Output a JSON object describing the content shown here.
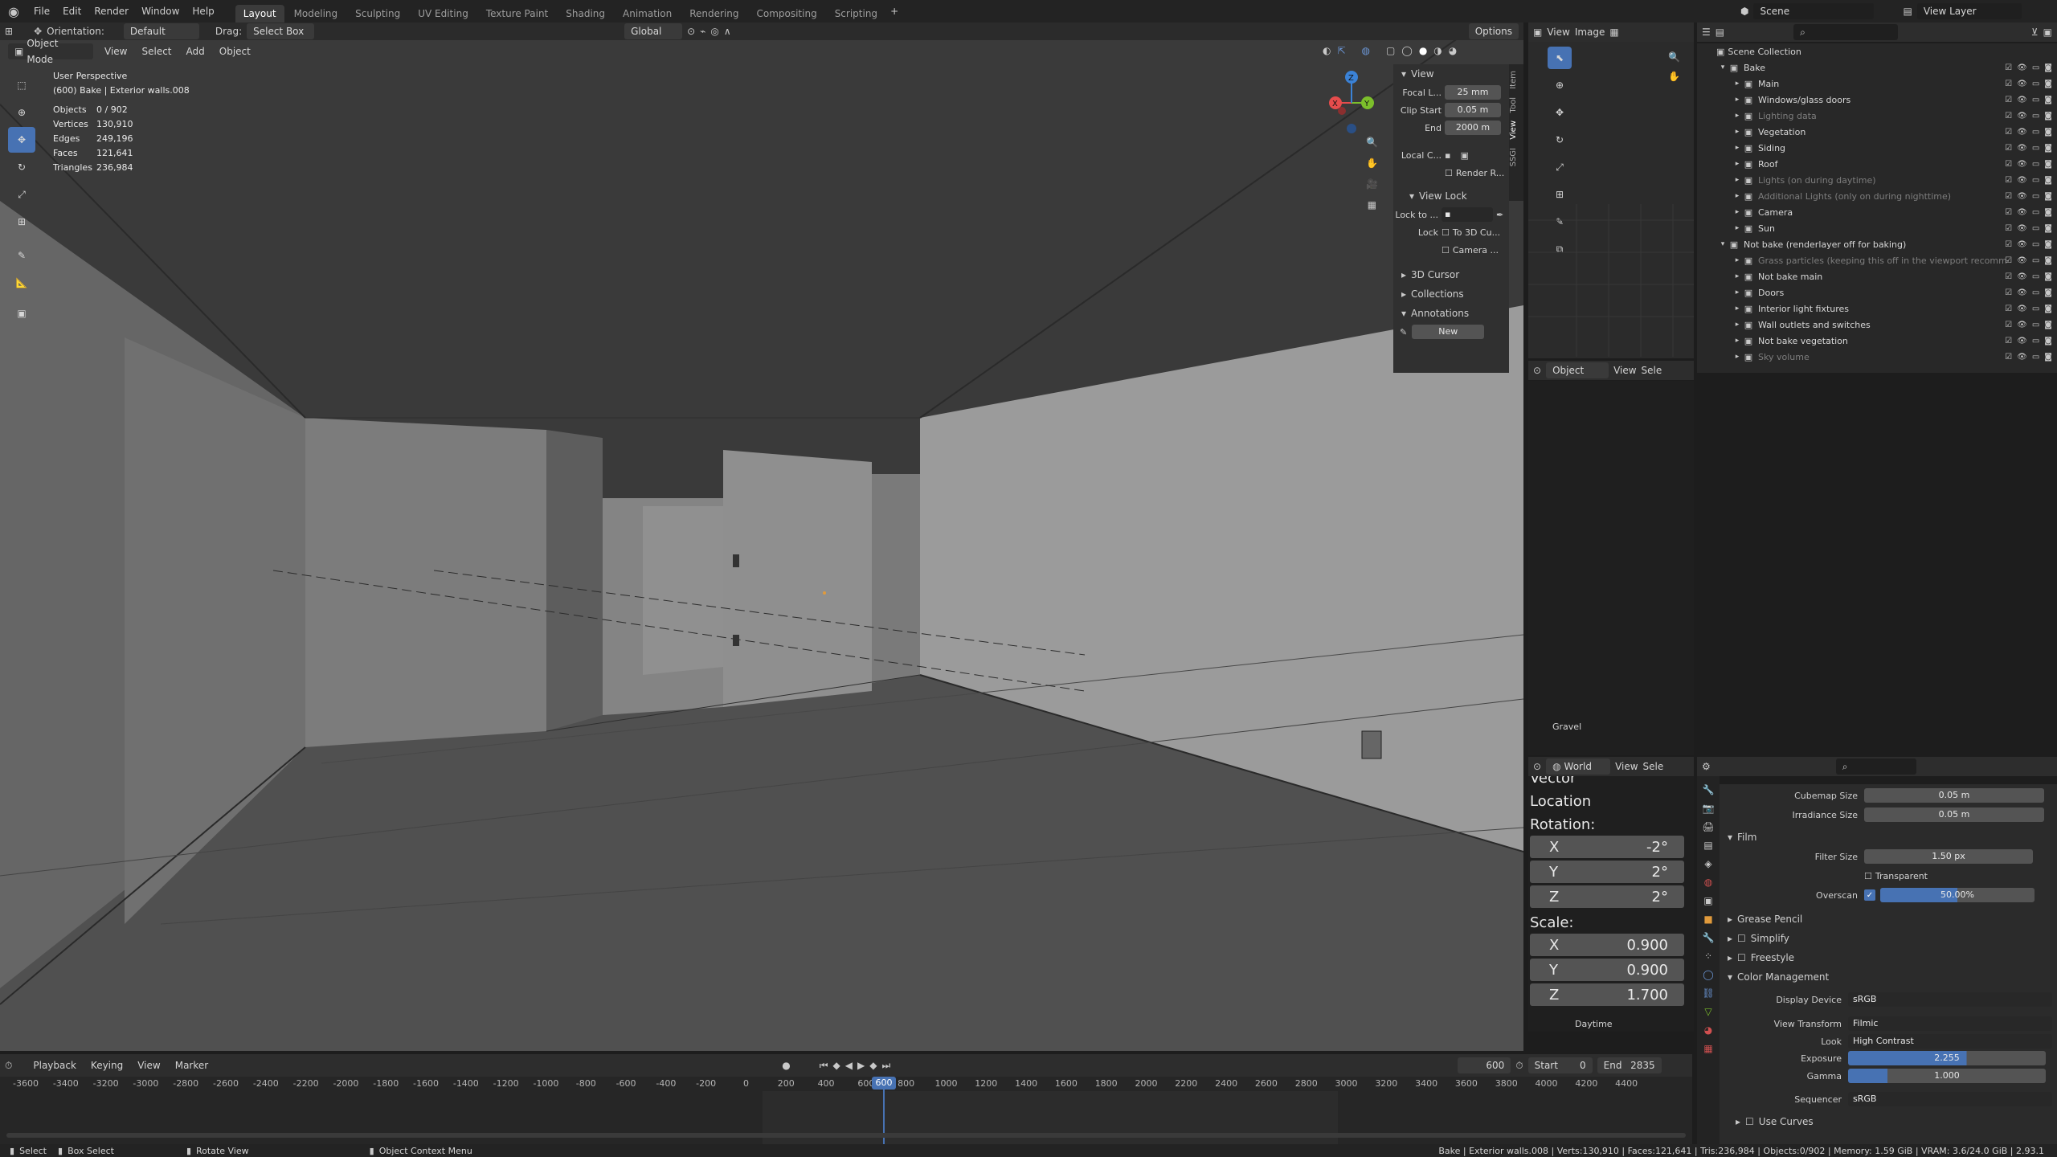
{
  "topbar": {
    "menus": [
      "File",
      "Edit",
      "Render",
      "Window",
      "Help"
    ],
    "workspaces": [
      "Layout",
      "Modeling",
      "Sculpting",
      "UV Editing",
      "Texture Paint",
      "Shading",
      "Animation",
      "Rendering",
      "Compositing",
      "Scripting"
    ],
    "active_workspace": "Layout",
    "scene_label": "Scene",
    "view_layer_label": "View Layer"
  },
  "tool_header": {
    "orientation_label": "Orientation:",
    "orientation_value": "Default",
    "drag_label": "Drag:",
    "drag_value": "Select Box",
    "transform_orientation": "Global",
    "options_label": "Options"
  },
  "viewport_header": {
    "mode": "Object Mode",
    "menus": [
      "View",
      "Select",
      "Add",
      "Object"
    ]
  },
  "viewport_overlay": {
    "perspective": "User Perspective",
    "object_info": "(600) Bake | Exterior walls.008",
    "stats": [
      {
        "label": "Objects",
        "value": "0 / 902"
      },
      {
        "label": "Vertices",
        "value": "130,910"
      },
      {
        "label": "Edges",
        "value": "249,196"
      },
      {
        "label": "Faces",
        "value": "121,641"
      },
      {
        "label": "Triangles",
        "value": "236,984"
      }
    ]
  },
  "npanel": {
    "tabs": [
      "Item",
      "Tool",
      "View",
      "SSGI"
    ],
    "view_header": "View",
    "focal_label": "Focal L...",
    "focal_value": "25 mm",
    "clip_start_label": "Clip Start",
    "clip_start_value": "0.05 m",
    "clip_end_label": "End",
    "clip_end_value": "2000 m",
    "local_camera_label": "Local C...",
    "render_region_label": "Render R...",
    "view_lock_header": "View Lock",
    "lock_to_label": "Lock to ...",
    "lock_label": "Lock",
    "lock_3d_cursor": "To 3D Cu...",
    "lock_camera": "Camera ...",
    "sections": [
      "3D Cursor",
      "Collections",
      "Annotations"
    ],
    "new_button": "New"
  },
  "image_editor": {
    "menus": [
      "View",
      "Image"
    ],
    "image_label": "Gravel",
    "obj_header_mode": "Object",
    "obj_header_menus": [
      "View",
      "Sele"
    ]
  },
  "world_panel": {
    "mode": "World",
    "menus": [
      "View",
      "Sele"
    ],
    "vector_label": "Vector",
    "location_label": "Location",
    "rotation_label": "Rotation:",
    "rotation": [
      {
        "axis": "X",
        "value": "-2°"
      },
      {
        "axis": "Y",
        "value": "2°"
      },
      {
        "axis": "Z",
        "value": "2°"
      }
    ],
    "scale_label": "Scale:",
    "scale": [
      {
        "axis": "X",
        "value": "0.900"
      },
      {
        "axis": "Y",
        "value": "0.900"
      },
      {
        "axis": "Z",
        "value": "1.700"
      }
    ],
    "footer_label": "Daytime"
  },
  "outliner": {
    "root": "Scene Collection",
    "rows": [
      {
        "label": "Bake",
        "indent": 1,
        "expanded": true,
        "dim": false
      },
      {
        "label": "Main",
        "indent": 2,
        "dim": false
      },
      {
        "label": "Windows/glass doors",
        "indent": 2,
        "dim": false
      },
      {
        "label": "Lighting data",
        "indent": 2,
        "dim": true
      },
      {
        "label": "Vegetation",
        "indent": 2,
        "dim": false
      },
      {
        "label": "Siding",
        "indent": 2,
        "dim": false
      },
      {
        "label": "Roof",
        "indent": 2,
        "dim": false
      },
      {
        "label": "Lights (on during daytime)",
        "indent": 2,
        "dim": true
      },
      {
        "label": "Additional Lights (only on during nighttime)",
        "indent": 2,
        "dim": true
      },
      {
        "label": "Camera",
        "indent": 2,
        "dim": false
      },
      {
        "label": "Sun",
        "indent": 2,
        "dim": false
      },
      {
        "label": "Not bake (renderlayer off for baking)",
        "indent": 1,
        "expanded": true,
        "dim": false
      },
      {
        "label": "Grass particles (keeping this off in the viewport recomm",
        "indent": 2,
        "dim": true
      },
      {
        "label": "Not bake main",
        "indent": 2,
        "dim": false
      },
      {
        "label": "Doors",
        "indent": 2,
        "dim": false
      },
      {
        "label": "Interior light fixtures",
        "indent": 2,
        "dim": false
      },
      {
        "label": "Wall outlets and switches",
        "indent": 2,
        "dim": false
      },
      {
        "label": "Not bake vegetation",
        "indent": 2,
        "dim": false
      },
      {
        "label": "Sky volume",
        "indent": 2,
        "dim": true
      }
    ]
  },
  "properties": {
    "cubemap_label": "Cubemap Size",
    "cubemap_value": "0.05 m",
    "irradiance_label": "Irradiance Size",
    "irradiance_value": "0.05 m",
    "film_header": "Film",
    "filter_label": "Filter Size",
    "filter_value": "1.50 px",
    "transparent_label": "Transparent",
    "overscan_label": "Overscan",
    "overscan_value": "50.00%",
    "overscan_fraction": 0.5,
    "grease_pencil": "Grease Pencil",
    "simplify": "Simplify",
    "freestyle": "Freestyle",
    "color_mgmt": "Color Management",
    "display_device_label": "Display Device",
    "display_device_value": "sRGB",
    "view_transform_label": "View Transform",
    "view_transform_value": "Filmic",
    "look_label": "Look",
    "look_value": "High Contrast",
    "exposure_label": "Exposure",
    "exposure_value": "2.255",
    "gamma_label": "Gamma",
    "gamma_value": "1.000",
    "sequencer_label": "Sequencer",
    "sequencer_value": "sRGB",
    "use_curves": "Use Curves"
  },
  "timeline": {
    "menus": [
      "Playback",
      "Keying",
      "View",
      "Marker"
    ],
    "current_frame": "600",
    "start_label": "Start",
    "start_value": "0",
    "end_label": "End",
    "end_value": "2835",
    "ticks": [
      "-3600",
      "-3400",
      "-3200",
      "-3000",
      "-2800",
      "-2600",
      "-2400",
      "-2200",
      "-2000",
      "-1800",
      "-1600",
      "-1400",
      "-1200",
      "-1000",
      "-800",
      "-600",
      "-400",
      "-200",
      "0",
      "200",
      "400",
      "600",
      "800",
      "1000",
      "1200",
      "1400",
      "1600",
      "1800",
      "2000",
      "2200",
      "2400",
      "2600",
      "2800",
      "3000",
      "3200",
      "3400",
      "3600",
      "3800",
      "4000",
      "4200",
      "4400"
    ],
    "playhead_label": "600"
  },
  "statusbar": {
    "select": "Select",
    "box_select": "Box Select",
    "rotate_view": "Rotate View",
    "context_menu": "Object Context Menu",
    "info": "Bake | Exterior walls.008 | Verts:130,910 | Faces:121,641 | Tris:236,984 | Objects:0/902 | Memory: 1.59 GiB | VRAM: 3.6/24.0 GiB | 2.93.1"
  },
  "colors": {
    "accent": "#4772b3",
    "bg": "#1d1d1d",
    "header": "#2d2d2d",
    "x_axis": "#e64c4c",
    "y_axis": "#7cbf2b",
    "z_axis": "#3b82d6"
  }
}
